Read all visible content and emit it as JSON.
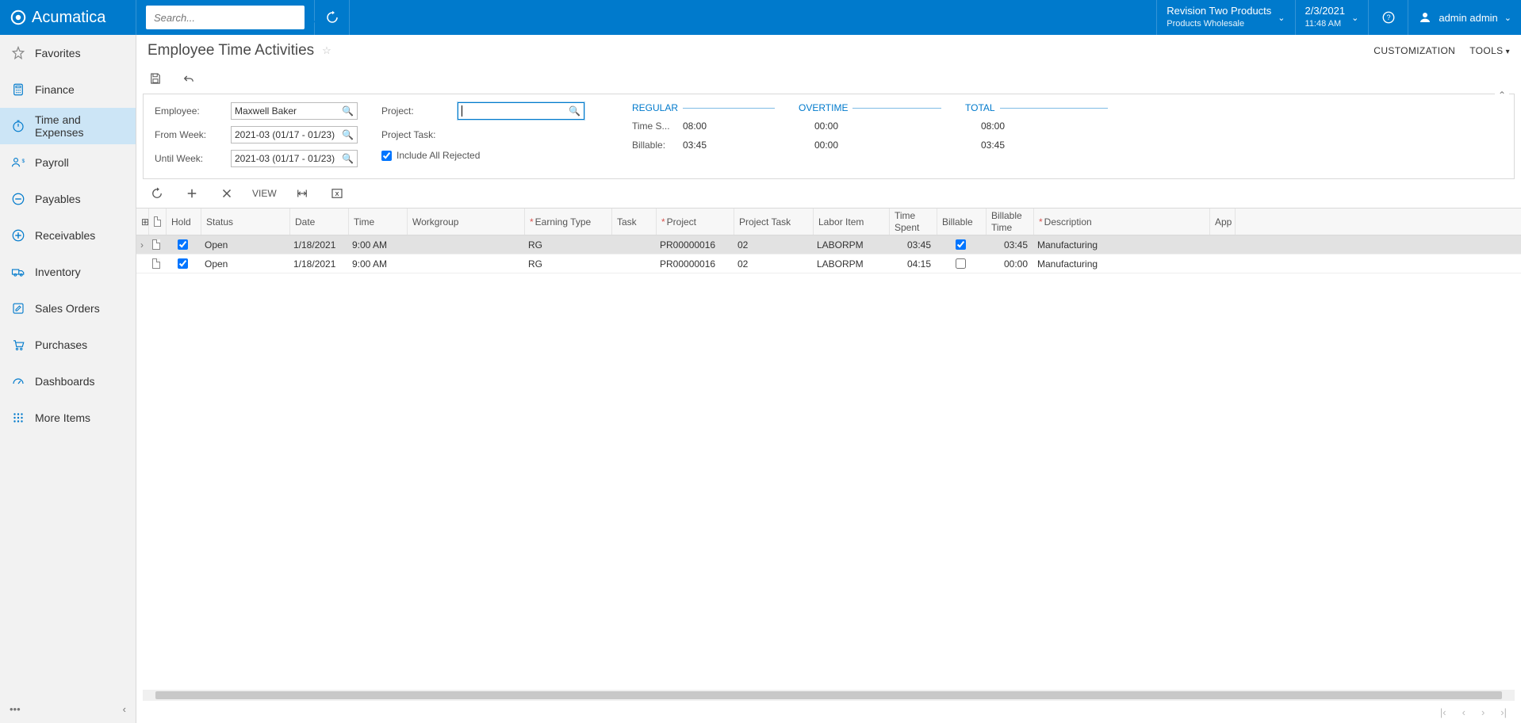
{
  "brand": "Acumatica",
  "search": {
    "placeholder": "Search..."
  },
  "topbar": {
    "company": {
      "title": "Revision Two Products",
      "sub": "Products Wholesale"
    },
    "date": {
      "title": "2/3/2021",
      "sub": "11:48 AM"
    },
    "user": {
      "label": "admin admin"
    }
  },
  "sidebar": {
    "items": [
      {
        "label": "Favorites"
      },
      {
        "label": "Finance"
      },
      {
        "label": "Time and Expenses"
      },
      {
        "label": "Payroll"
      },
      {
        "label": "Payables"
      },
      {
        "label": "Receivables"
      },
      {
        "label": "Inventory"
      },
      {
        "label": "Sales Orders"
      },
      {
        "label": "Purchases"
      },
      {
        "label": "Dashboards"
      },
      {
        "label": "More Items"
      }
    ]
  },
  "page": {
    "title": "Employee Time Activities",
    "customization": "CUSTOMIZATION",
    "tools": "TOOLS"
  },
  "filters": {
    "employee_label": "Employee:",
    "employee_value": "Maxwell Baker",
    "from_label": "From Week:",
    "from_value": "2021-03 (01/17 - 01/23)",
    "until_label": "Until Week:",
    "until_value": "2021-03 (01/17 - 01/23)",
    "project_label": "Project:",
    "project_task_label": "Project Task:",
    "include_rejected_label": "Include All Rejected"
  },
  "stats": {
    "regular": {
      "header": "REGULAR",
      "time_spent_label": "Time S...",
      "time_spent": "08:00",
      "billable_label": "Billable:",
      "billable": "03:45"
    },
    "overtime": {
      "header": "OVERTIME",
      "time_spent": "00:00",
      "billable": "00:00"
    },
    "total": {
      "header": "TOTAL",
      "time_spent": "08:00",
      "billable": "03:45"
    }
  },
  "grid_tb": {
    "view": "VIEW"
  },
  "grid": {
    "headers": {
      "hold": "Hold",
      "status": "Status",
      "date": "Date",
      "time": "Time",
      "workgroup": "Workgroup",
      "earning": "Earning Type",
      "task": "Task",
      "project": "Project",
      "ptask": "Project Task",
      "labor": "Labor Item",
      "tspent1": "Time",
      "tspent2": "Spent",
      "billable": "Billable",
      "btime1": "Billable",
      "btime2": "Time",
      "description": "Description",
      "approver": "App"
    },
    "rows": [
      {
        "status": "Open",
        "date": "1/18/2021",
        "time": "9:00 AM",
        "earning": "RG",
        "project": "PR00000016",
        "ptask": "02",
        "labor": "LABORPM",
        "tspent": "03:45",
        "billable": true,
        "btime": "03:45",
        "desc": "Manufacturing"
      },
      {
        "status": "Open",
        "date": "1/18/2021",
        "time": "9:00 AM",
        "earning": "RG",
        "project": "PR00000016",
        "ptask": "02",
        "labor": "LABORPM",
        "tspent": "04:15",
        "billable": false,
        "btime": "00:00",
        "desc": "Manufacturing"
      }
    ]
  }
}
